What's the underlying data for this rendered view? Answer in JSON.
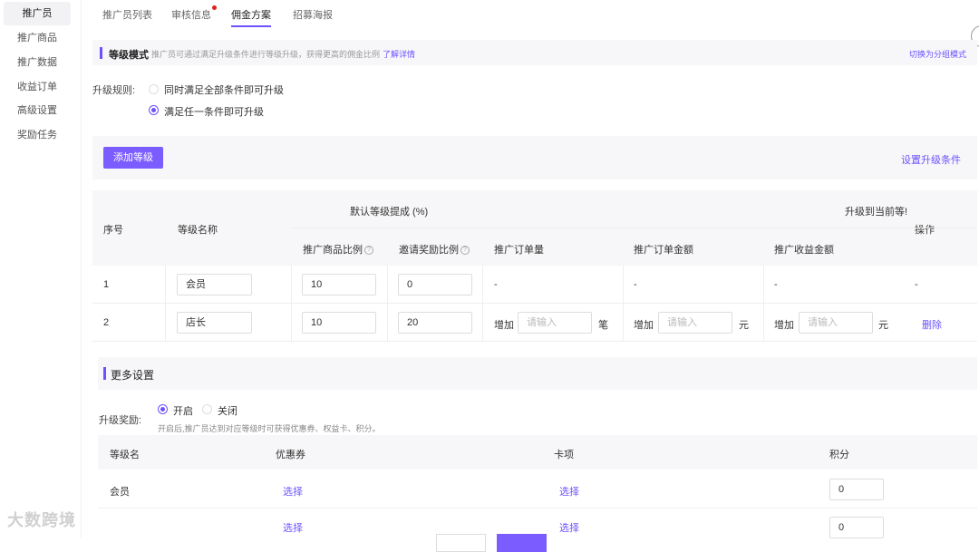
{
  "sidebar": {
    "items": [
      {
        "label": "推广员",
        "active": true
      },
      {
        "label": "推广商品"
      },
      {
        "label": "推广数据"
      },
      {
        "label": "收益订单"
      },
      {
        "label": "高级设置"
      },
      {
        "label": "奖励任务"
      }
    ]
  },
  "tabs": [
    {
      "label": "推广员列表"
    },
    {
      "label": "审核信息",
      "badge": true
    },
    {
      "label": "佣金方案",
      "active": true
    },
    {
      "label": "招募海报"
    }
  ],
  "level_mode": {
    "title": "等级模式",
    "desc": "推广员可通过满足升级条件进行等级升级，获得更高的佣金比例",
    "more_link": "了解详情",
    "switch_link": "切换为分组模式"
  },
  "upgrade_rule": {
    "label": "升级规则:",
    "options": [
      {
        "label": "同时满足全部条件即可升级",
        "selected": false
      },
      {
        "label": "满足任一条件即可升级",
        "selected": true
      }
    ]
  },
  "actions": {
    "add_level": "添加等级",
    "set_conditions": "设置升级条件"
  },
  "level_table": {
    "headers": {
      "index": "序号",
      "name": "等级名称",
      "default_group": "默认等级提成 (%)",
      "upgrade_group": "升级到当前等!",
      "operation": "操作",
      "product_ratio": "推广商品比例",
      "invite_ratio": "邀请奖励比例",
      "order_count": "推广订单量",
      "order_amount": "推广订单金额",
      "income_amount": "推广收益金额"
    },
    "rows": [
      {
        "index": "1",
        "name": "会员",
        "product_ratio": "10",
        "invite_ratio": "0",
        "order_count": "-",
        "order_amount": "-",
        "income_amount": "-",
        "op": "-"
      },
      {
        "index": "2",
        "name": "店长",
        "product_ratio": "10",
        "invite_ratio": "20",
        "increase": "增加",
        "placeholder": "请输入",
        "unit_count": "笔",
        "unit_money": "元",
        "op": "删除"
      }
    ]
  },
  "more_settings": {
    "title": "更多设置",
    "reward_label": "升级奖励:",
    "on_label": "开启",
    "off_label": "关闭",
    "hint": "开启后,推广员达到对应等级时可获得优惠券、权益卡、积分。"
  },
  "reward_table": {
    "headers": {
      "level": "等级名",
      "coupon": "优惠券",
      "card": "卡项",
      "points": "积分"
    },
    "rows": [
      {
        "level": "会员",
        "coupon": "选择",
        "card": "选择",
        "points": "0"
      },
      {
        "level": "",
        "coupon": "选择",
        "card": "选择",
        "points": "0"
      }
    ]
  },
  "watermark": "大数跨境",
  "colors": {
    "accent": "#6b52ff",
    "button": "#7a5cff",
    "badge": "#e02020"
  }
}
